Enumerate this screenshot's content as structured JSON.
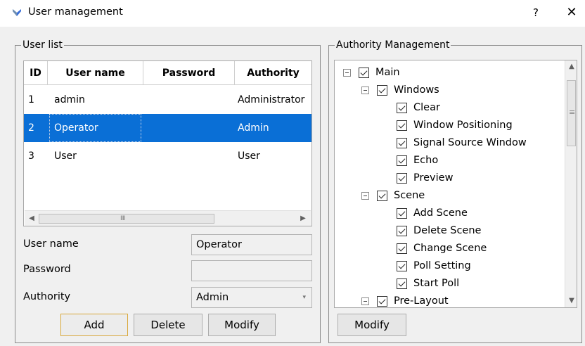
{
  "window": {
    "title": "User management",
    "help_label": "?",
    "close_label": "✕"
  },
  "user_list": {
    "group_title": "User list",
    "columns": [
      "ID",
      "User name",
      "Password",
      "Authority"
    ],
    "rows": [
      {
        "id": "1",
        "user_name": "admin",
        "password": "",
        "authority": "Administrator",
        "selected": false
      },
      {
        "id": "2",
        "user_name": "Operator",
        "password": "",
        "authority": "Admin",
        "selected": true
      },
      {
        "id": "3",
        "user_name": "User",
        "password": "",
        "authority": "User",
        "selected": false
      }
    ],
    "hscroll_grip": "IIII"
  },
  "form": {
    "user_name_label": "User name",
    "user_name_value": "Operator",
    "password_label": "Password",
    "password_value": "",
    "authority_label": "Authority",
    "authority_value": "Admin",
    "caret": "▾"
  },
  "buttons": {
    "add": "Add",
    "delete": "Delete",
    "modify": "Modify"
  },
  "authority": {
    "group_title": "Authority Management",
    "modify_label": "Modify",
    "tree": [
      {
        "label": "Main",
        "level": 0,
        "expander": true
      },
      {
        "label": "Windows",
        "level": 1,
        "expander": true
      },
      {
        "label": "Clear",
        "level": 2,
        "expander": false
      },
      {
        "label": "Window Positioning",
        "level": 2,
        "expander": false
      },
      {
        "label": "Signal Source Window",
        "level": 2,
        "expander": false
      },
      {
        "label": "Echo",
        "level": 2,
        "expander": false
      },
      {
        "label": "Preview",
        "level": 2,
        "expander": false
      },
      {
        "label": "Scene",
        "level": 1,
        "expander": true
      },
      {
        "label": "Add Scene",
        "level": 2,
        "expander": false
      },
      {
        "label": "Delete Scene",
        "level": 2,
        "expander": false
      },
      {
        "label": "Change Scene",
        "level": 2,
        "expander": false
      },
      {
        "label": "Poll Setting",
        "level": 2,
        "expander": false
      },
      {
        "label": "Start Poll",
        "level": 2,
        "expander": false
      },
      {
        "label": "Pre-Layout",
        "level": 1,
        "expander": true
      }
    ],
    "vscroll_grip": "≡"
  },
  "icons": {
    "app": "app-icon",
    "help": "help-icon",
    "close": "close-icon"
  },
  "colors": {
    "selection": "#0a6fd6",
    "default_button_border": "#d9a83b"
  }
}
